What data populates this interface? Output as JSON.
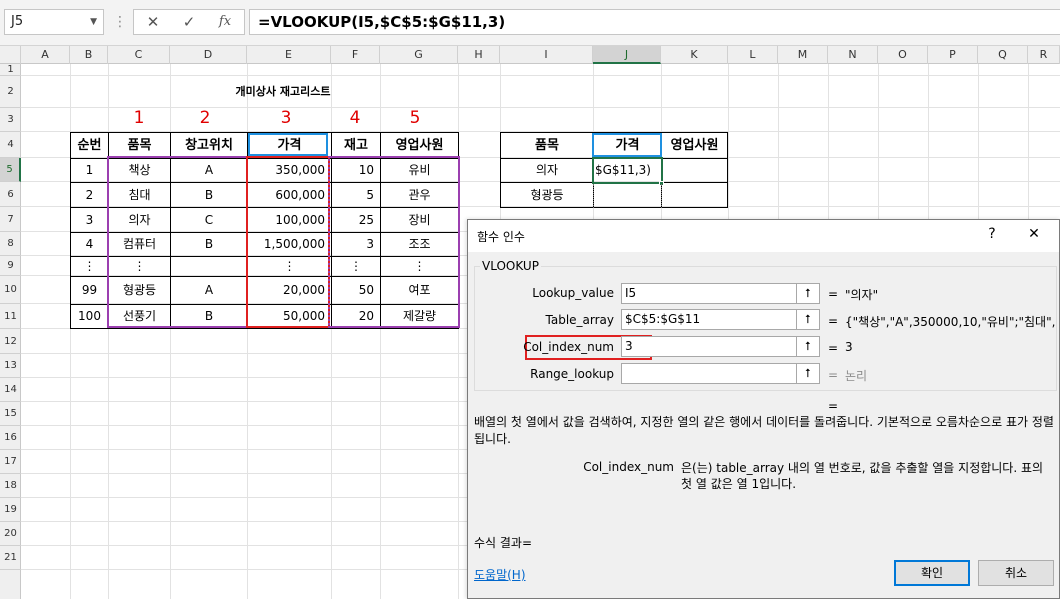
{
  "formula_bar": {
    "name_box": "J5",
    "dots": "⋮",
    "cancel_icon": "✕",
    "enter_icon": "✓",
    "fx_label": "fx",
    "formula": "=VLOOKUP(I5,$C$5:$G$11,3)"
  },
  "columns": [
    "A",
    "B",
    "C",
    "D",
    "E",
    "F",
    "G",
    "H",
    "I",
    "J",
    "K",
    "L",
    "M",
    "N",
    "O",
    "P",
    "Q",
    "R"
  ],
  "rows": [
    "1",
    "2",
    "3",
    "4",
    "5",
    "6",
    "7",
    "8",
    "9",
    "10",
    "11",
    "12",
    "13",
    "14",
    "15",
    "16",
    "17",
    "18",
    "19",
    "20",
    "21"
  ],
  "sheet": {
    "title": "개미상사 재고리스트",
    "markers": [
      "1",
      "2",
      "3",
      "4",
      "5"
    ],
    "main_table": {
      "headers": [
        "순번",
        "품목",
        "창고위치",
        "가격",
        "재고",
        "영업사원"
      ],
      "rows": [
        [
          "1",
          "책상",
          "A",
          "350,000",
          "10",
          "유비"
        ],
        [
          "2",
          "침대",
          "B",
          "600,000",
          "5",
          "관우"
        ],
        [
          "3",
          "의자",
          "C",
          "100,000",
          "25",
          "장비"
        ],
        [
          "4",
          "컴퓨터",
          "B",
          "1,500,000",
          "3",
          "조조"
        ],
        [
          "⋮",
          "⋮",
          "",
          "⋮",
          "⋮",
          "⋮"
        ],
        [
          "99",
          "형광등",
          "A",
          "20,000",
          "50",
          "여포"
        ],
        [
          "100",
          "선풍기",
          "B",
          "50,000",
          "20",
          "제갈량"
        ]
      ]
    },
    "lookup_table": {
      "headers": [
        "품목",
        "가격",
        "영업사원"
      ],
      "rows": [
        [
          "의자",
          "$G$11,3)",
          ""
        ],
        [
          "형광등",
          "",
          ""
        ]
      ]
    }
  },
  "dialog": {
    "title": "함수 인수",
    "help_icon": "?",
    "close_icon": "✕",
    "function_name": "VLOOKUP",
    "args": [
      {
        "label": "Lookup_value",
        "value": "I5",
        "eq": "=",
        "result": "\"의자\""
      },
      {
        "label": "Table_array",
        "value": "$C$5:$G$11",
        "eq": "=",
        "result": "{\"책상\",\"A\",350000,10,\"유비\";\"침대\","
      },
      {
        "label": "Col_index_num",
        "value": "3",
        "eq": "=",
        "result": "3"
      },
      {
        "label": "Range_lookup",
        "value": "",
        "eq": "=",
        "result": "논리"
      }
    ],
    "ref_icon": "⭡",
    "total_eq": "=",
    "description": "배열의 첫 열에서 값을 검색하여, 지정한 열의 같은 행에서 데이터를 돌려줍니다. 기본적으로 오름차순으로 표가 정렬됩니다.",
    "param_name": "Col_index_num",
    "param_desc": "은(는) table_array 내의 열 번호로, 값을 추출할 열을 지정합니다. 표의 첫 열 값은 열 1입니다.",
    "formula_result_label": "수식 결과=",
    "help_link": "도움말(H)",
    "ok_label": "확인",
    "cancel_label": "취소",
    "colors": {
      "highlight_red": "#e02020",
      "purple": "#9b3fb0",
      "blue": "#1e90e0",
      "link": "#0066cc"
    }
  }
}
